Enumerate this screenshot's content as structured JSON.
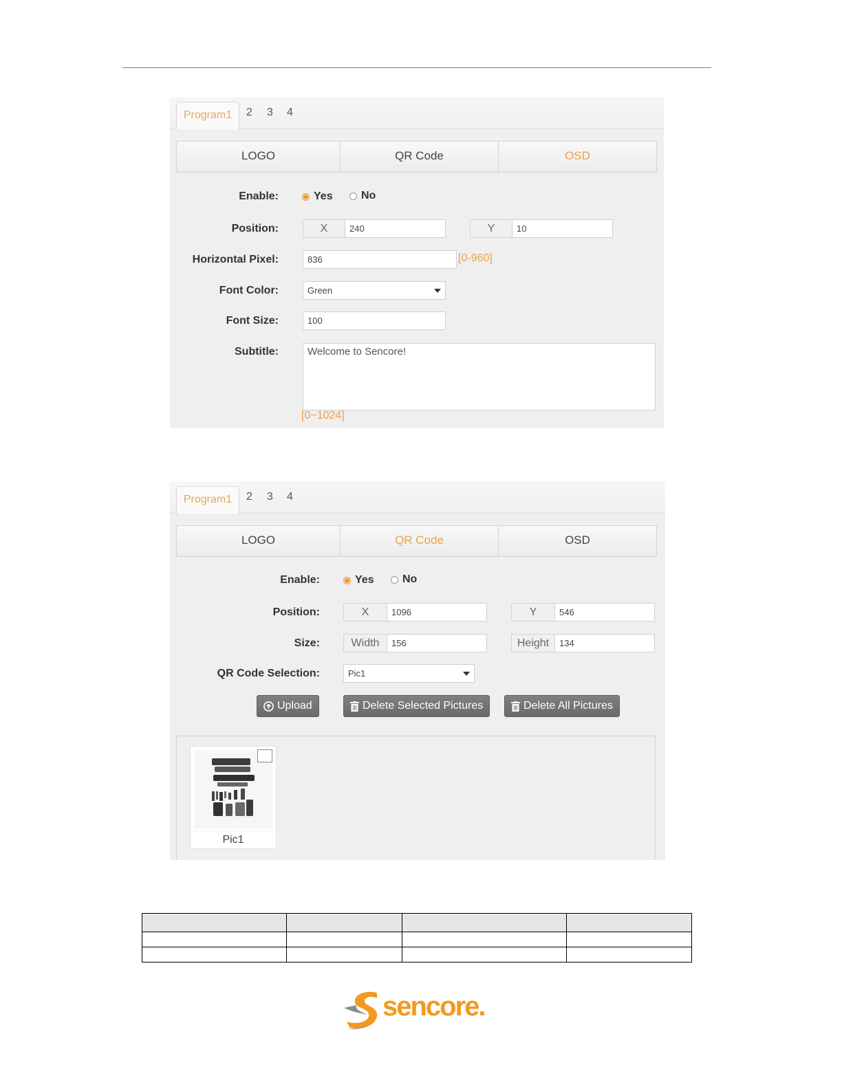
{
  "panel_osd": {
    "program_tab": "Program1",
    "number_tabs": [
      "2",
      "3",
      "4"
    ],
    "subtabs": [
      "LOGO",
      "QR Code",
      "OSD"
    ],
    "active_subtab": "OSD",
    "enable": {
      "label": "Enable:",
      "yes": "Yes",
      "no": "No",
      "selected": "Yes"
    },
    "position": {
      "label": "Position:",
      "x_label": "X",
      "x_value": "240",
      "y_label": "Y",
      "y_value": "10"
    },
    "horizontal_pixel": {
      "label": "Horizontal Pixel:",
      "value": "836",
      "range": "[0-960]"
    },
    "font_color": {
      "label": "Font Color:",
      "value": "Green"
    },
    "font_size": {
      "label": "Font Size:",
      "value": "100"
    },
    "subtitle": {
      "label": "Subtitle:",
      "value": "Welcome to Sencore!",
      "range": "[0~1024]"
    }
  },
  "panel_qr": {
    "program_tab": "Program1",
    "number_tabs": [
      "2",
      "3",
      "4"
    ],
    "subtabs": [
      "LOGO",
      "QR Code",
      "OSD"
    ],
    "active_subtab": "QR Code",
    "enable": {
      "label": "Enable:",
      "yes": "Yes",
      "no": "No",
      "selected": "Yes"
    },
    "position": {
      "label": "Position:",
      "x_label": "X",
      "x_value": "1096",
      "y_label": "Y",
      "y_value": "546"
    },
    "size": {
      "label": "Size:",
      "width_label": "Width",
      "width_value": "156",
      "height_label": "Height",
      "height_value": "134"
    },
    "qr_selection": {
      "label": "QR Code Selection:",
      "value": "Pic1"
    },
    "buttons": {
      "upload": "Upload",
      "delete_selected": "Delete Selected Pictures",
      "delete_all": "Delete All Pictures"
    },
    "gallery": [
      {
        "caption": "Pic1"
      }
    ]
  },
  "logo": {
    "text": "sencore."
  },
  "colors": {
    "accent": "#e8a248",
    "brand_orange": "#f29a1f",
    "brand_grey": "#8c8c8c",
    "button": "#727272",
    "panel_bg": "#efefef"
  }
}
